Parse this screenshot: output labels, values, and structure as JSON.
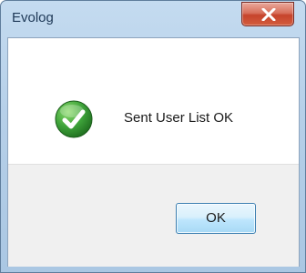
{
  "window": {
    "title": "Evolog",
    "close_label": "X"
  },
  "dialog": {
    "icon": "success-checkmark-icon",
    "message": "Sent User List OK",
    "ok_label": "OK"
  },
  "colors": {
    "titlebar": "#b5cfe8",
    "close_button": "#c6442c",
    "success_icon": "#3ea33a",
    "button_border": "#3c7fb1"
  }
}
